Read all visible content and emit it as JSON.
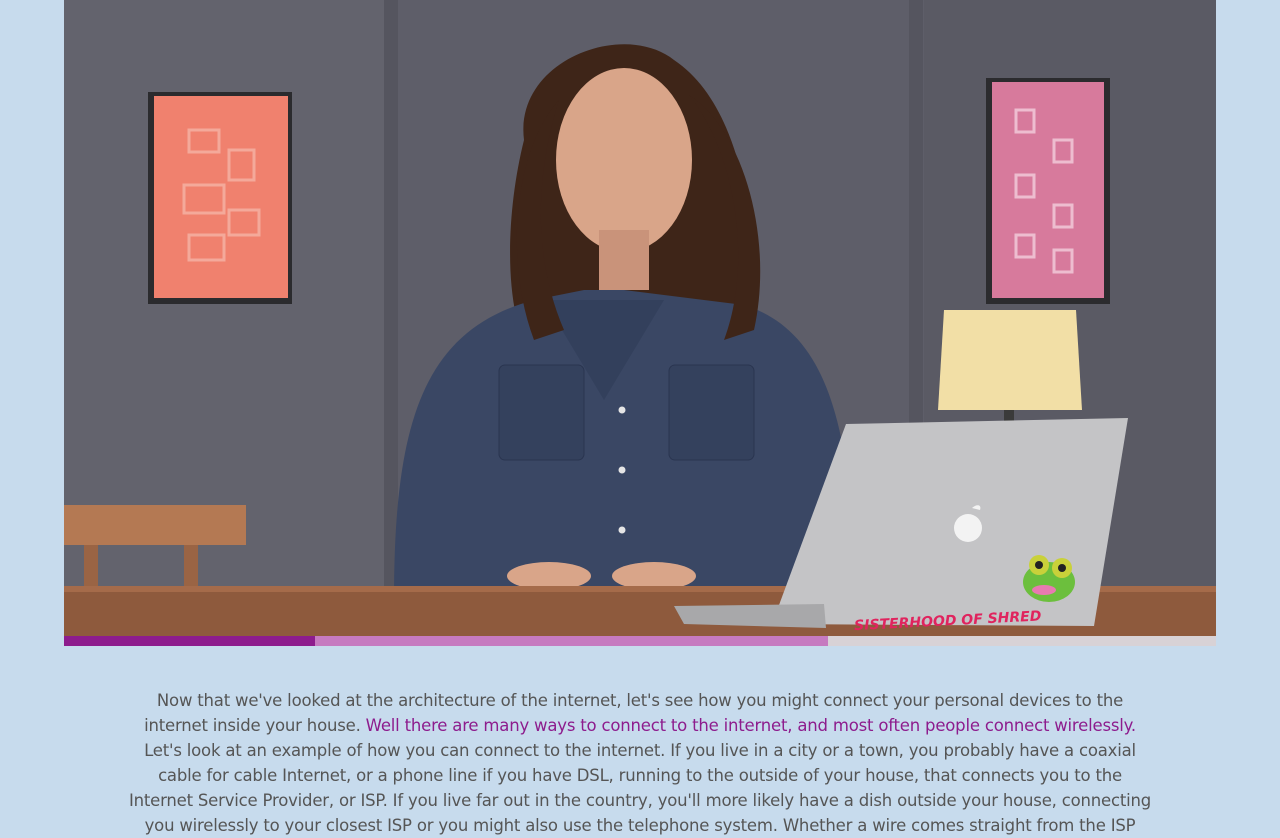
{
  "video": {
    "progress": {
      "played": 0.218,
      "buffered": 0.663
    },
    "laptop_sticker_text": "SISTERHOOD OF SHRED"
  },
  "transcript": {
    "segments": [
      {
        "text": "Now that we've looked at the architecture of the internet, let's see how you might connect your personal devices to the internet inside your house. ",
        "active": false
      },
      {
        "text": "Well there are many ways to connect to the internet, and most often people connect wirelessly. ",
        "active": true
      },
      {
        "text": "Let's look at an example of how you can connect to the internet. If you live in a city or a town, you probably have a coaxial cable for cable Internet, or a phone line if you have DSL, running to the outside of your house, that connects you to the Internet Service Provider, or ISP. If you live far out in the country, you'll more likely have a dish outside your house, connecting you wirelessly to your closest ISP or you might also use the telephone system. Whether a wire comes straight from the ISP",
        "active": false
      }
    ]
  },
  "colors": {
    "page_background": "#c7dbed",
    "accent": "#8d1c8d",
    "buffered": "#c67ac0",
    "text": "#555555"
  }
}
